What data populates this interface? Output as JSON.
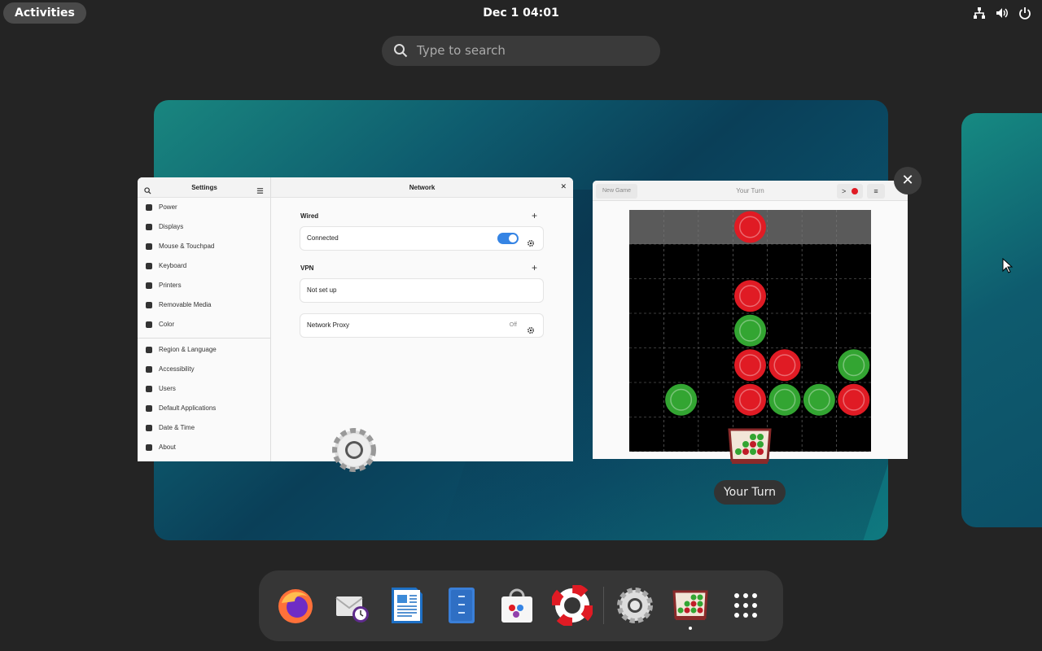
{
  "topbar": {
    "activities_label": "Activities",
    "clock": "Dec 1  04:01",
    "icons": [
      "network-icon",
      "volume-icon",
      "power-icon"
    ]
  },
  "search": {
    "placeholder": "Type to search"
  },
  "settings_window": {
    "sidebar_title": "Settings",
    "page_title": "Network",
    "sidebar_items": [
      {
        "label": "Power",
        "icon": "power-icon"
      },
      {
        "label": "Displays",
        "icon": "display-icon"
      },
      {
        "label": "Mouse & Touchpad",
        "icon": "mouse-icon"
      },
      {
        "label": "Keyboard",
        "icon": "keyboard-icon"
      },
      {
        "label": "Printers",
        "icon": "printer-icon"
      },
      {
        "label": "Removable Media",
        "icon": "media-icon"
      },
      {
        "label": "Color",
        "icon": "color-icon"
      },
      {
        "label": "Region & Language",
        "icon": "flag-icon"
      },
      {
        "label": "Accessibility",
        "icon": "accessibility-icon"
      },
      {
        "label": "Users",
        "icon": "users-icon"
      },
      {
        "label": "Default Applications",
        "icon": "star-icon"
      },
      {
        "label": "Date & Time",
        "icon": "clock-icon"
      },
      {
        "label": "About",
        "icon": "info-icon"
      }
    ],
    "wired": {
      "title": "Wired",
      "status": "Connected",
      "enabled": true
    },
    "vpn": {
      "title": "VPN",
      "status": "Not set up"
    },
    "proxy": {
      "label": "Network Proxy",
      "value": "Off"
    }
  },
  "game_window": {
    "new_game_label": "New Game",
    "title": "Your Turn",
    "hint_label": ">",
    "menu_label": "≡",
    "colors": {
      "red": "#e01b24",
      "green": "#33a532"
    },
    "board": {
      "cols": 7,
      "rows": 6,
      "drop_piece": {
        "col": 3,
        "color": "red"
      },
      "pieces": [
        {
          "col": 3,
          "row": 1,
          "color": "red"
        },
        {
          "col": 3,
          "row": 2,
          "color": "green"
        },
        {
          "col": 3,
          "row": 3,
          "color": "red"
        },
        {
          "col": 4,
          "row": 3,
          "color": "red"
        },
        {
          "col": 6,
          "row": 3,
          "color": "green"
        },
        {
          "col": 1,
          "row": 4,
          "color": "green"
        },
        {
          "col": 3,
          "row": 4,
          "color": "red"
        },
        {
          "col": 4,
          "row": 4,
          "color": "green"
        },
        {
          "col": 5,
          "row": 4,
          "color": "green"
        },
        {
          "col": 6,
          "row": 4,
          "color": "red"
        }
      ]
    }
  },
  "tooltip": "Your Turn",
  "close_label": "✕",
  "dash": {
    "items": [
      {
        "name": "firefox",
        "running": false
      },
      {
        "name": "evolution-mail",
        "running": false
      },
      {
        "name": "libreoffice-writer",
        "running": false
      },
      {
        "name": "files",
        "running": false
      },
      {
        "name": "software",
        "running": false
      },
      {
        "name": "help",
        "running": false
      },
      {
        "name": "settings",
        "running": false
      },
      {
        "name": "four-in-a-row",
        "running": true
      },
      {
        "name": "show-apps",
        "running": false
      }
    ]
  }
}
